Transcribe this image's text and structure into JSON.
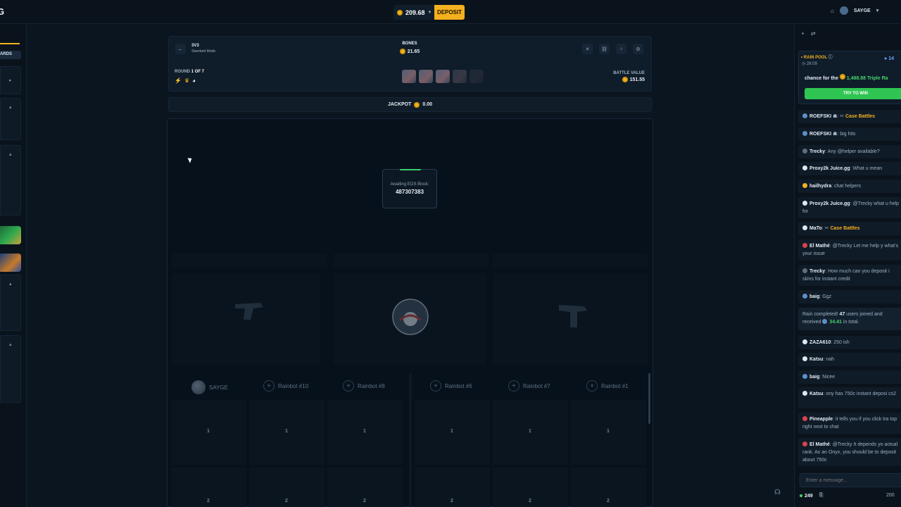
{
  "header": {
    "logo": "G",
    "balance": "209.68",
    "deposit_label": "DEPOSIT",
    "username": "SAYGE"
  },
  "leftnav": {
    "rewards_label": "ARDS"
  },
  "battle": {
    "mode_title": "3V3",
    "mode_sub": "Standard Mode",
    "case_name": "BONES",
    "case_price": "21.65",
    "round_prefix": "ROUND",
    "round_value": "1 OF 7",
    "battle_value_label": "BATTLE VALUE",
    "battle_value": "151.55",
    "jackpot_label": "JACKPOT",
    "jackpot_value": "0.00",
    "eos_label": "Awaiting EOS Block:",
    "eos_block": "487307383"
  },
  "players": [
    {
      "name": "SAYGE",
      "avatar": true
    },
    {
      "name": "Rainbot #10",
      "avatar": false
    },
    {
      "name": "Rainbot #8",
      "avatar": false
    },
    {
      "name": "Rainbot #6",
      "avatar": false
    },
    {
      "name": "Rainbot #7",
      "avatar": false
    },
    {
      "name": "Rainbot #1",
      "avatar": false
    }
  ],
  "slots": {
    "row1": "1",
    "row2": "2"
  },
  "chat": {
    "rain_title": "RAIN POOL",
    "rain_time": "28:09",
    "rain_amount": "14",
    "rain_chance_prefix": "chance for the",
    "rain_chance_amount": "1,488.88",
    "rain_chance_suffix": "Triple Ra",
    "try_label": "TRY TO WIN",
    "messages": [
      {
        "user": "ROEFSKI",
        "text": "Case Battles",
        "style": "y"
      },
      {
        "user": "ROEFSKI",
        "text": "big hits",
        "style": ""
      },
      {
        "user": "Trecky",
        "text": "Any @helper available?",
        "style": ""
      },
      {
        "user": "Proxy2k Juice.gg",
        "text": "What u mean",
        "style": ""
      },
      {
        "user": "hailhydra",
        "text": "chat helpers",
        "style": ""
      },
      {
        "user": "Proxy2k Juice.gg",
        "text": "@Trecky  what u help for",
        "style": ""
      },
      {
        "user": "MaTo",
        "text": "Case Battles",
        "style": "y"
      },
      {
        "user": "El Mathé",
        "text": "@Trecky  Let me help y what's your issue",
        "style": ""
      },
      {
        "user": "Trecky",
        "text": "How much can you deposit i skins for instant credit",
        "style": ""
      },
      {
        "user": "baig",
        "text": "Ggz",
        "style": ""
      },
      {
        "user": "",
        "text": "Rain completed! 47 users joined and received 34.41 in total.",
        "style": "rain"
      },
      {
        "user": "ZAZA610",
        "text": "250 ish",
        "style": ""
      },
      {
        "user": "Katsu",
        "text": "nah",
        "style": ""
      },
      {
        "user": "baig",
        "text": "Nicee",
        "style": ""
      },
      {
        "user": "Katsu",
        "text": "ony has 750c instant deposi cs2",
        "style": ""
      },
      {
        "user": "Pineapple",
        "text": "it tells you if you click tra top right next to chat",
        "style": ""
      },
      {
        "user": "El Mathé",
        "text": "@Trecky  It depends yo actual rank. As an Onyx, you should be to deposit about 750c",
        "style": ""
      }
    ],
    "rain_done_prefix": "Rain completed!",
    "rain_done_users": "47",
    "rain_done_mid": "users joined and received",
    "rain_done_amount": "34.41",
    "rain_done_suffix": "in total.",
    "input_placeholder": "Enter a message...",
    "online": "249",
    "limit": "200"
  },
  "colors": {
    "accent": "#f5b01f",
    "green": "#2fc552",
    "bg": "#0b1520"
  }
}
